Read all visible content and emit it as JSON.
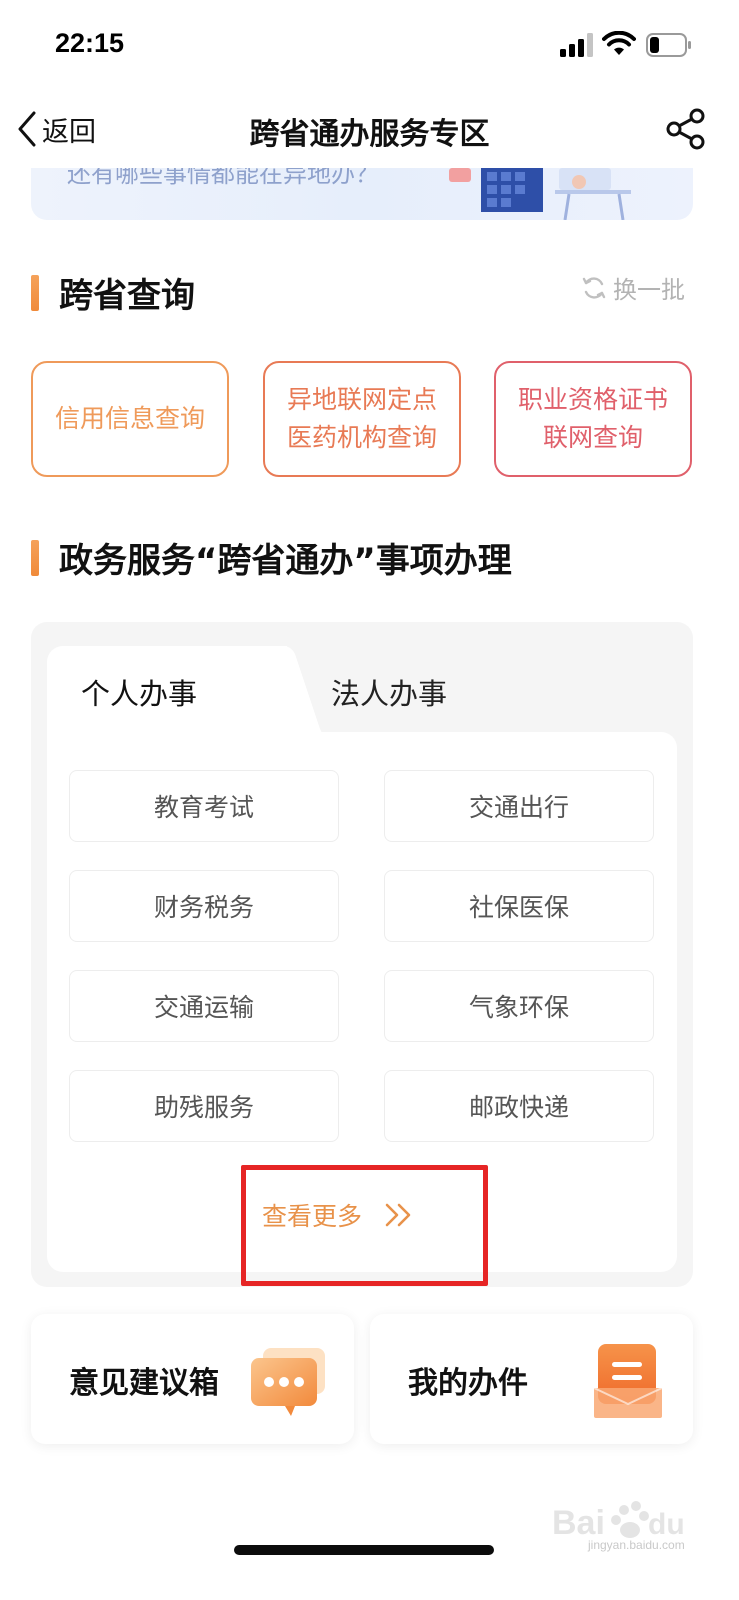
{
  "status_bar": {
    "time": "22:15"
  },
  "nav": {
    "back_label": "返回",
    "title": "跨省通办服务专区"
  },
  "banner": {
    "text": "还有哪些事情都能在异地办？"
  },
  "query_section": {
    "title": "跨省查询",
    "refresh_label": "换一批",
    "cards": [
      {
        "label": "信用信息查询",
        "color": "#ef9a5a"
      },
      {
        "label": "异地联网定点医药机构查询",
        "color": "#e87a55"
      },
      {
        "label": "职业资格证书联网查询",
        "color": "#e0606b"
      }
    ]
  },
  "service_section": {
    "title": "政务服务“跨省通办”事项办理",
    "tabs": [
      {
        "label": "个人办事",
        "active": true
      },
      {
        "label": "法人办事",
        "active": false
      }
    ],
    "items": [
      "教育考试",
      "交通出行",
      "财务税务",
      "社保医保",
      "交通运输",
      "气象环保",
      "助残服务",
      "邮政快递"
    ],
    "more_label": "查看更多"
  },
  "bottom_cards": [
    {
      "label": "意见建议箱",
      "icon": "chat-bubble-icon"
    },
    {
      "label": "我的办件",
      "icon": "document-tray-icon"
    }
  ],
  "watermark": {
    "sub": "jingyan.baidu.com"
  },
  "colors": {
    "accent": "#f08a3a",
    "highlight": "#e62525"
  }
}
